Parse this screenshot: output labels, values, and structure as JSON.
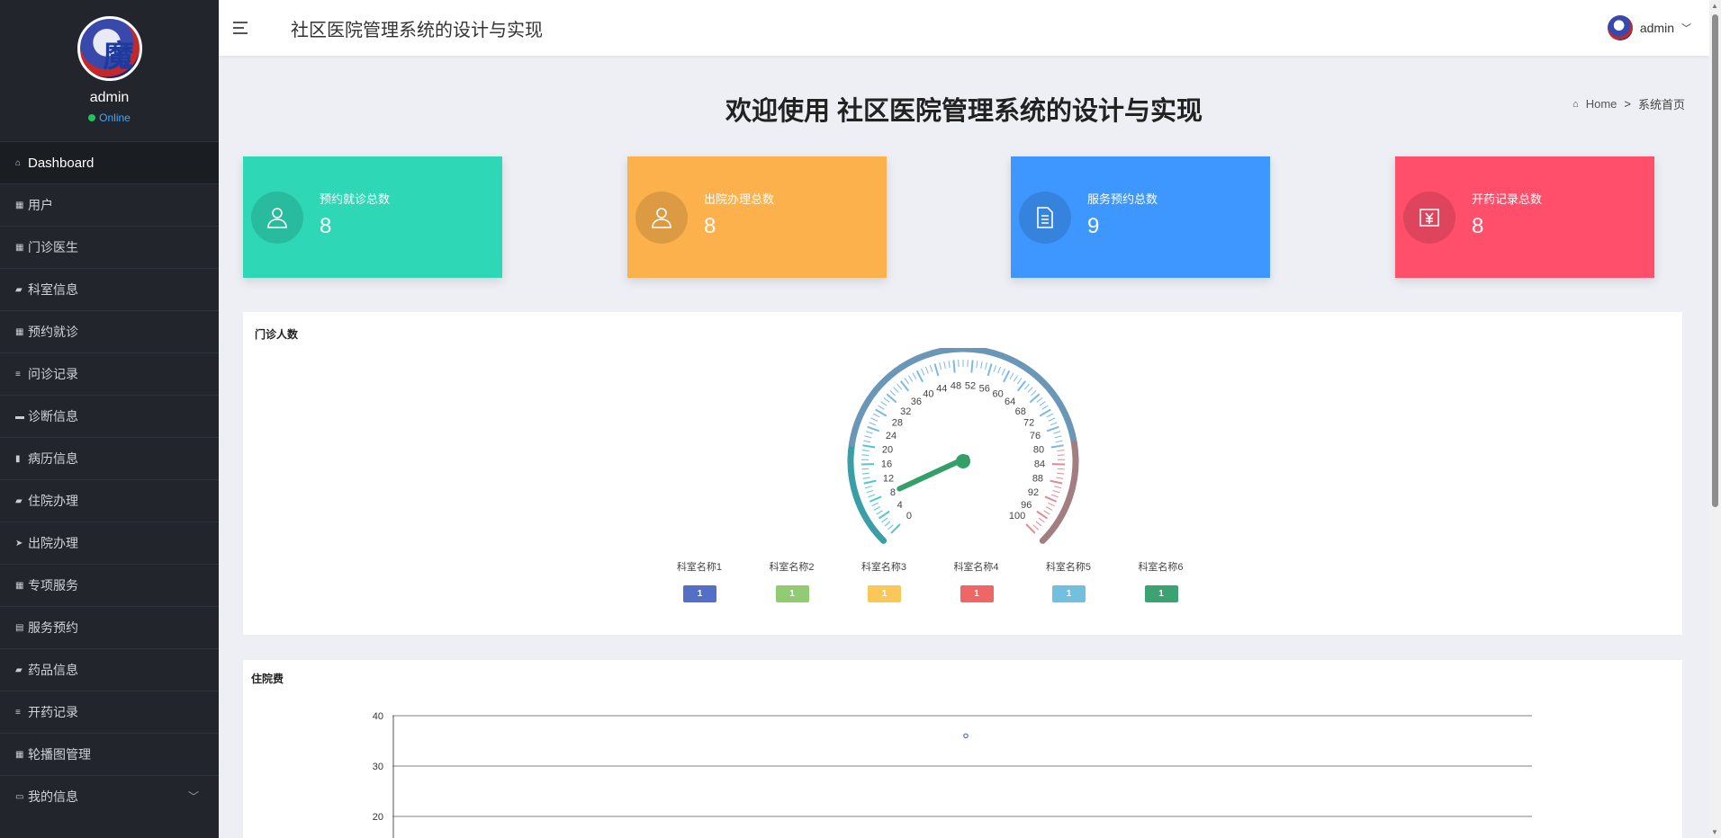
{
  "app": {
    "title": "社区医院管理系统的设计与实现"
  },
  "sidebar": {
    "username": "admin",
    "status": "Online",
    "items": [
      {
        "label": "Dashboard",
        "icon": "home-icon"
      },
      {
        "label": "用户",
        "icon": "grid-icon"
      },
      {
        "label": "门诊医生",
        "icon": "grid-icon"
      },
      {
        "label": "科室信息",
        "icon": "comment-icon"
      },
      {
        "label": "预约就诊",
        "icon": "grid-icon"
      },
      {
        "label": "问诊记录",
        "icon": "list-icon"
      },
      {
        "label": "诊断信息",
        "icon": "ticket-icon"
      },
      {
        "label": "病历信息",
        "icon": "bar-chart-icon"
      },
      {
        "label": "住院办理",
        "icon": "comment-icon"
      },
      {
        "label": "出院办理",
        "icon": "send-icon"
      },
      {
        "label": "专项服务",
        "icon": "grid-icon"
      },
      {
        "label": "服务预约",
        "icon": "clipboard-icon"
      },
      {
        "label": "药品信息",
        "icon": "comment-icon"
      },
      {
        "label": "开药记录",
        "icon": "list-icon"
      },
      {
        "label": "轮播图管理",
        "icon": "grid-icon"
      },
      {
        "label": "我的信息",
        "icon": "window-icon"
      }
    ]
  },
  "topbar": {
    "title": "社区医院管理系统的设计与实现",
    "username": "admin"
  },
  "header": {
    "welcome": "欢迎使用 社区医院管理系统的设计与实现",
    "breadcrumb_home": "Home",
    "breadcrumb_sep": ">",
    "breadcrumb_current": "系统首页"
  },
  "cards": [
    {
      "label": "预约就诊总数",
      "value": "8",
      "color": "#2ed7b6",
      "icon": "user-icon"
    },
    {
      "label": "出院办理总数",
      "value": "8",
      "color": "#fdb14d",
      "icon": "user-icon"
    },
    {
      "label": "服务预约总数",
      "value": "9",
      "color": "#3e97ff",
      "icon": "document-icon"
    },
    {
      "label": "开药记录总数",
      "value": "8",
      "color": "#ff4f6a",
      "icon": "yuan-icon"
    }
  ],
  "gauge_panel": {
    "title": "门诊人数",
    "tick_labels": [
      "0",
      "4",
      "8",
      "12",
      "16",
      "20",
      "24",
      "28",
      "32",
      "36",
      "40",
      "44",
      "48",
      "52",
      "56",
      "60",
      "64",
      "68",
      "72",
      "76",
      "80",
      "84",
      "88",
      "92",
      "96",
      "100"
    ],
    "value": 8,
    "legend": [
      {
        "name": "科室名称1",
        "value": "1",
        "color": "#5470c6"
      },
      {
        "name": "科室名称2",
        "value": "1",
        "color": "#91cc75"
      },
      {
        "name": "科室名称3",
        "value": "1",
        "color": "#fac858"
      },
      {
        "name": "科室名称4",
        "value": "1",
        "color": "#ee6666"
      },
      {
        "name": "科室名称5",
        "value": "1",
        "color": "#73c0de"
      },
      {
        "name": "科室名称6",
        "value": "1",
        "color": "#3ba272"
      }
    ]
  },
  "line_panel": {
    "title": "住院费"
  },
  "chart_data": {
    "type": "scatter",
    "title": "住院费",
    "y_ticks": [
      "40",
      "30",
      "20"
    ],
    "points": [
      {
        "y": 36
      }
    ]
  }
}
